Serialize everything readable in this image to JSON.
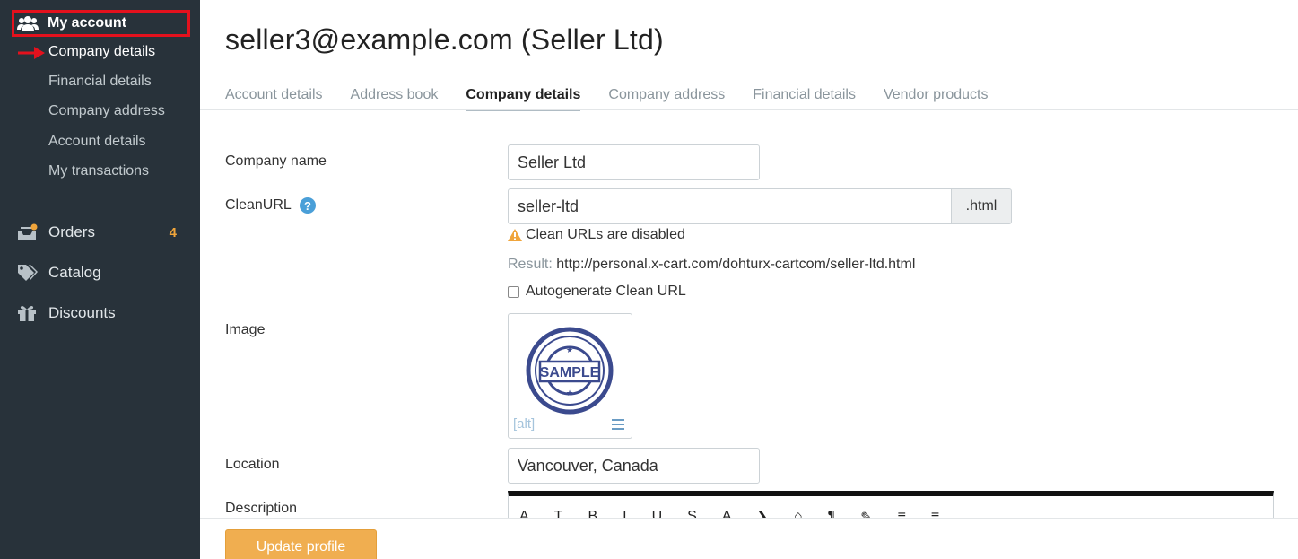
{
  "sidebar": {
    "my_account": "My account",
    "sub_items": [
      {
        "label": "Company details"
      },
      {
        "label": "Financial details"
      },
      {
        "label": "Company address"
      },
      {
        "label": "Account details"
      },
      {
        "label": "My transactions"
      }
    ],
    "items": [
      {
        "label": "Orders",
        "badge": "4",
        "icon": "inbox-icon"
      },
      {
        "label": "Catalog",
        "icon": "tags-icon"
      },
      {
        "label": "Discounts",
        "icon": "gift-icon"
      }
    ],
    "highlight_color": "#e4111d"
  },
  "page": {
    "title": "seller3@example.com (Seller Ltd)"
  },
  "tabs": [
    {
      "label": "Account details"
    },
    {
      "label": "Address book"
    },
    {
      "label": "Company details"
    },
    {
      "label": "Company address"
    },
    {
      "label": "Financial details"
    },
    {
      "label": "Vendor products"
    }
  ],
  "form": {
    "company_name_label": "Company name",
    "company_name_value": "Seller Ltd",
    "cleanurl_label": "CleanURL",
    "cleanurl_value": "seller-ltd",
    "cleanurl_suffix": ".html",
    "cleanurl_warning": "Clean URLs are disabled",
    "result_label": "Result:",
    "result_value": "http://personal.x-cart.com/dohturx-cartcom/seller-ltd.html",
    "autogenerate_label": "Autogenerate Clean URL",
    "image_label": "Image",
    "image_alt": "[alt]",
    "image_stamp_text": "SAMPLE",
    "location_label": "Location",
    "location_value": "Vancouver, Canada",
    "description_label": "Description"
  },
  "editor_tools": [
    "A",
    "T",
    "B",
    "I",
    "U",
    "S",
    "A",
    "❯",
    "⌂",
    "¶",
    "✎",
    "≡",
    "≡"
  ],
  "actions": {
    "update_label": "Update profile"
  },
  "colors": {
    "sidebar_bg": "#28323a",
    "accent": "#f0ae50",
    "badge": "#f0a53b",
    "help": "#4a9fd8"
  }
}
